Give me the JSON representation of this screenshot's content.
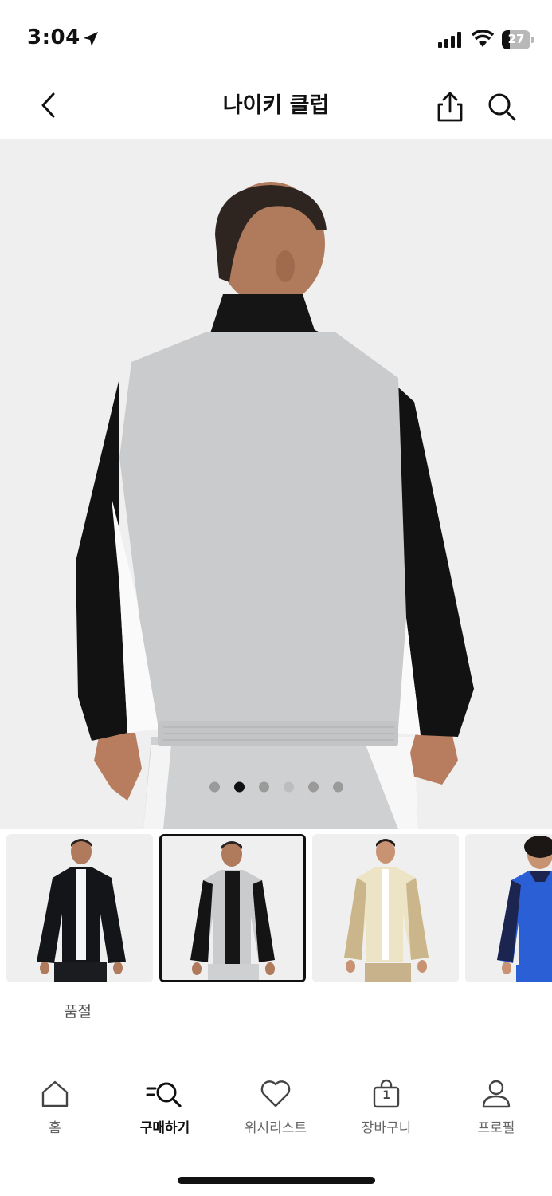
{
  "status_bar": {
    "time": "3:04",
    "battery": "27"
  },
  "header": {
    "title": "나이키 클럽"
  },
  "gallery": {
    "dot_count": 6,
    "active_dot": 1
  },
  "product": {
    "availability": "품절"
  },
  "tabbar": {
    "home": "홈",
    "shop": "구매하기",
    "wishlist": "위시리스트",
    "bag": "장바구니",
    "bag_count": "1",
    "profile": "프로필"
  },
  "colors": {
    "accent": "#111111",
    "background": "#ffffff",
    "image_bg": "#efefef"
  }
}
